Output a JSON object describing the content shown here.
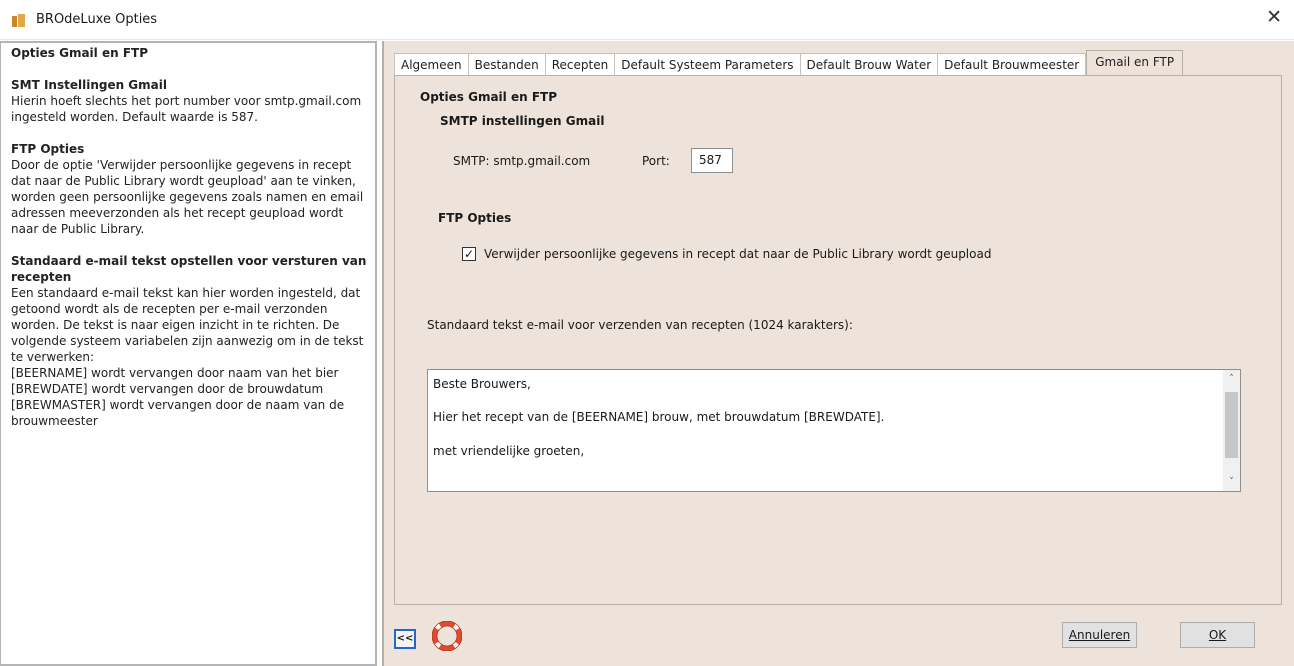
{
  "window": {
    "title": "BROdeLuxe Opties",
    "close_symbol": "✕",
    "icon": "app-icon"
  },
  "help": {
    "title": "Opties Gmail en FTP",
    "smt_title": "SMT Instellingen Gmail",
    "smt_lines": [
      "Hierin hoeft slechts het port number voor smtp.gmail.com",
      "ingesteld worden. Default waarde is 587."
    ],
    "ftp_title": "FTP Opties",
    "ftp_lines": [
      "Door de optie 'Verwijder persoonlijke gegevens in recept",
      "dat naar de Public Library wordt geupload' aan te vinken,",
      "worden geen persoonlijke gegevens zoals namen en email",
      "adressen meeverzonden als het recept geupload wordt",
      "naar de Public Library."
    ],
    "mail_title_1": "Standaard e-mail tekst opstellen voor versturen van",
    "mail_title_2": "recepten",
    "mail_lines": [
      "Een standaard e-mail tekst kan hier worden ingesteld, dat",
      "getoond wordt als de recepten per e-mail verzonden",
      "worden. De tekst is naar eigen inzicht in te richten. De",
      "volgende systeem variabelen zijn aanwezig om in de tekst",
      "te verwerken:",
      "[BEERNAME] wordt vervangen door naam van het bier",
      "[BREWDATE] wordt vervangen door de brouwdatum",
      "[BREWMASTER] wordt vervangen door de naam van de",
      "brouwmeester"
    ]
  },
  "tabs": [
    {
      "label": "Algemeen",
      "active": false
    },
    {
      "label": "Bestanden",
      "active": false
    },
    {
      "label": "Recepten",
      "active": false
    },
    {
      "label": "Default Systeem Parameters",
      "active": false
    },
    {
      "label": "Default Brouw Water",
      "active": false
    },
    {
      "label": "Default Brouwmeester",
      "active": false
    },
    {
      "label": "Gmail en FTP",
      "active": true
    }
  ],
  "gmail": {
    "section_title": "Opties Gmail en FTP",
    "smtp_title": "SMTP instellingen Gmail",
    "smtp_label": "SMTP: smtp.gmail.com",
    "port_label": "Port:",
    "port_value": "587"
  },
  "ftp": {
    "title": "FTP Opties",
    "remove_personal_label": "Verwijder persoonlijke gegevens in recept dat naar de Public Library wordt geupload",
    "remove_personal_checked": true,
    "check_mark": "✓"
  },
  "email": {
    "label": "Standaard tekst e-mail voor verzenden van recepten (1024 karakters):",
    "lines": [
      "Beste Brouwers,",
      "Hier het recept van de [BEERNAME] brouw, met brouwdatum [BREWDATE].",
      "met vriendelijke groeten,"
    ],
    "scroll_up": "˄",
    "scroll_down": "˅"
  },
  "footer": {
    "collapse_label": "<<",
    "help_icon": "lifebuoy-icon",
    "cancel_label": "Annuleren",
    "ok_label": "OK"
  },
  "colors": {
    "panel_bg": "#ede3da",
    "active_focus": "#2467c8",
    "lifebuoy_red": "#e04a2f"
  }
}
